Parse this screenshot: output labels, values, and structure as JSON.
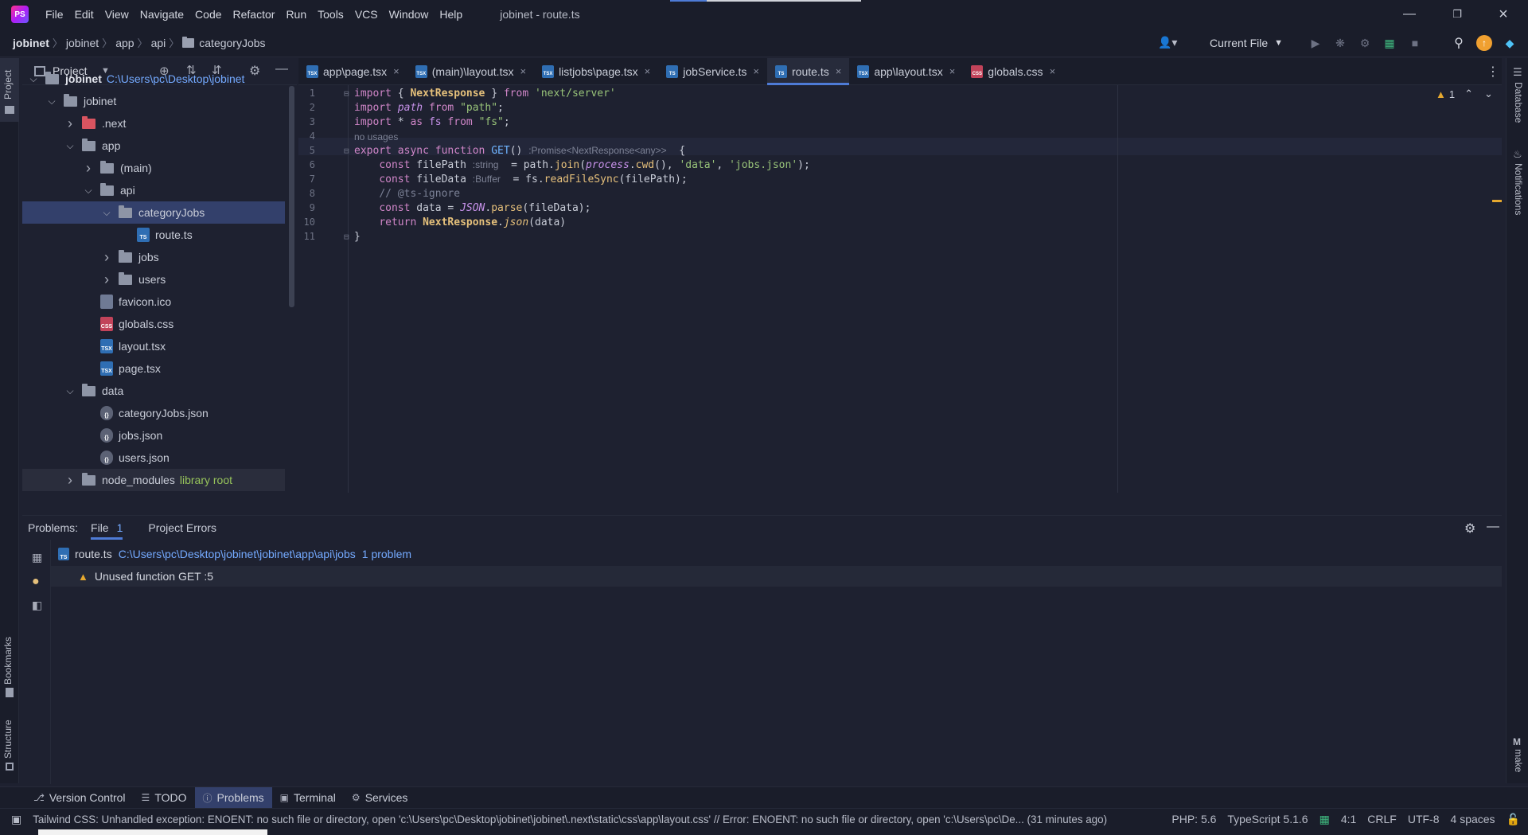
{
  "titlebar": {
    "logo_text": "PS",
    "menu": [
      "File",
      "Edit",
      "View",
      "Navigate",
      "Code",
      "Refactor",
      "Run",
      "Tools",
      "VCS",
      "Window",
      "Help"
    ],
    "window_title": "jobinet - route.ts"
  },
  "breadcrumbs": [
    "jobinet",
    "jobinet",
    "app",
    "api",
    "categoryJobs"
  ],
  "run_config": "Current File",
  "project_panel": {
    "title": "Project",
    "tree": [
      {
        "label": "jobinet",
        "extra": "C:\\Users\\pc\\Desktop\\jobinet",
        "kind": "folder",
        "depth": 0,
        "open": true,
        "bold": true
      },
      {
        "label": "jobinet",
        "kind": "folder",
        "depth": 1,
        "open": true
      },
      {
        "label": ".next",
        "kind": "folder-red",
        "depth": 2,
        "open": false
      },
      {
        "label": "app",
        "kind": "folder",
        "depth": 2,
        "open": true
      },
      {
        "label": "(main)",
        "kind": "folder",
        "depth": 3,
        "open": false
      },
      {
        "label": "api",
        "kind": "folder",
        "depth": 3,
        "open": true
      },
      {
        "label": "categoryJobs",
        "kind": "folder",
        "depth": 4,
        "open": true,
        "selected": true
      },
      {
        "label": "route.ts",
        "kind": "ts",
        "depth": 5
      },
      {
        "label": "jobs",
        "kind": "folder",
        "depth": 4,
        "open": false
      },
      {
        "label": "users",
        "kind": "folder",
        "depth": 4,
        "open": false
      },
      {
        "label": "favicon.ico",
        "kind": "ico",
        "depth": 3
      },
      {
        "label": "globals.css",
        "kind": "css",
        "depth": 3
      },
      {
        "label": "layout.tsx",
        "kind": "tsx",
        "depth": 3
      },
      {
        "label": "page.tsx",
        "kind": "tsx",
        "depth": 3
      },
      {
        "label": "data",
        "kind": "folder",
        "depth": 2,
        "open": true
      },
      {
        "label": "categoryJobs.json",
        "kind": "json",
        "depth": 3
      },
      {
        "label": "jobs.json",
        "kind": "json",
        "depth": 3
      },
      {
        "label": "users.json",
        "kind": "json",
        "depth": 3
      },
      {
        "label": "node_modules",
        "extra_green": "library root",
        "kind": "folder",
        "depth": 2,
        "open": false,
        "hl": true
      }
    ]
  },
  "tabs": [
    {
      "label": "app\\page.tsx",
      "kind": "tsx"
    },
    {
      "label": "(main)\\layout.tsx",
      "kind": "tsx"
    },
    {
      "label": "listjobs\\page.tsx",
      "kind": "tsx"
    },
    {
      "label": "jobService.ts",
      "kind": "ts"
    },
    {
      "label": "route.ts",
      "kind": "ts",
      "active": true
    },
    {
      "label": "app\\layout.tsx",
      "kind": "tsx"
    },
    {
      "label": "globals.css",
      "kind": "css"
    }
  ],
  "editor": {
    "warning_count": "1",
    "usages_hint": "no usages",
    "line_numbers": [
      "1",
      "2",
      "3",
      "4",
      "5",
      "6",
      "7",
      "8",
      "9",
      "10",
      "11"
    ]
  },
  "problems": {
    "label": "Problems:",
    "tab_file": "File",
    "tab_file_count": "1",
    "tab_project": "Project Errors",
    "file_name": "route.ts",
    "file_path": "C:\\Users\\pc\\Desktop\\jobinet\\jobinet\\app\\api\\jobs",
    "file_count": "1 problem",
    "item": "Unused function GET :5"
  },
  "right_strip": {
    "database": "Database",
    "notifications": "Notifications",
    "make": "make"
  },
  "left_strip": {
    "project": "Project",
    "bookmarks": "Bookmarks",
    "structure": "Structure"
  },
  "tool_windows": [
    {
      "label": "Version Control",
      "icon": "branch-icon"
    },
    {
      "label": "TODO",
      "icon": "list-icon"
    },
    {
      "label": "Problems",
      "icon": "info-icon",
      "active": true
    },
    {
      "label": "Terminal",
      "icon": "terminal-icon"
    },
    {
      "label": "Services",
      "icon": "gear-icon"
    }
  ],
  "statusbar": {
    "message": "Tailwind CSS: Unhandled exception: ENOENT: no such file or directory, open 'c:\\Users\\pc\\Desktop\\jobinet\\jobinet\\.next\\static\\css\\app\\layout.css' // Error: ENOENT: no such file or directory, open 'c:\\Users\\pc\\De... (31 minutes ago)",
    "php": "PHP: 5.6",
    "typescript": "TypeScript 5.1.6",
    "position": "4:1",
    "line_sep": "CRLF",
    "encoding": "UTF-8",
    "indent": "4 spaces"
  },
  "colors": {
    "accent": "#4e7bd6",
    "selected": "#33406b",
    "warning": "#e5a82f",
    "bg": "#1e2130"
  }
}
